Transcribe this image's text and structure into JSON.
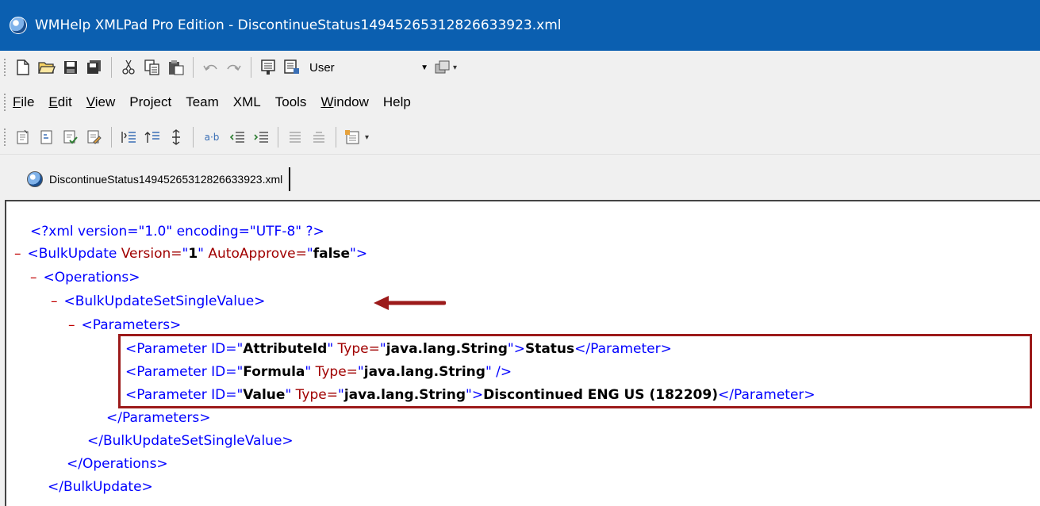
{
  "window": {
    "title": "WMHelp XMLPad Pro Edition - DiscontinueStatus14945265312826633923.xml"
  },
  "toolbar": {
    "profile_combo": "User",
    "icons": [
      "new-file-icon",
      "open-folder-icon",
      "save-icon",
      "save-all-icon",
      "cut-icon",
      "copy-icon",
      "paste-icon",
      "undo-icon",
      "redo-icon",
      "toggle-panel-icon",
      "tree-view-icon",
      "combo-dropdown-icon",
      "customize-icon"
    ]
  },
  "menu": {
    "items": [
      {
        "label": "File",
        "underline": "F"
      },
      {
        "label": "Edit",
        "underline": "E"
      },
      {
        "label": "View",
        "underline": "V"
      },
      {
        "label": "Project",
        "underline": ""
      },
      {
        "label": "Team",
        "underline": ""
      },
      {
        "label": "XML",
        "underline": ""
      },
      {
        "label": "Tools",
        "underline": ""
      },
      {
        "label": "Window",
        "underline": "W"
      },
      {
        "label": "Help",
        "underline": ""
      }
    ]
  },
  "tab": {
    "label": "DiscontinueStatus14945265312826633923.xml"
  },
  "xml": {
    "decl": "<?xml version=\"1.0\" encoding=\"UTF-8\" ?>",
    "bulk_open_tag": "<BulkUpdate",
    "bulk_attr1_name": " Version=",
    "bulk_attr1_q1": "\"",
    "bulk_attr1_value": "1",
    "bulk_attr1_q2": "\"",
    "bulk_attr2_name": " AutoApprove=",
    "bulk_attr2_q1": "\"",
    "bulk_attr2_value": "false",
    "bulk_attr2_q2": "\"",
    "bulk_close_bracket": ">",
    "operations_open": "<Operations>",
    "setsingle_open": "<BulkUpdateSetSingleValue>",
    "parameters_open": "<Parameters>",
    "param1": {
      "tag": "<Parameter ID=",
      "q": "\"",
      "id": "AttributeId",
      "type_attr": " Type=",
      "type": "java.lang.String",
      "gt": ">",
      "text": "Status",
      "close": "</Parameter>"
    },
    "param2": {
      "tag": "<Parameter ID=",
      "q": "\"",
      "id": "Formula",
      "type_attr": " Type=",
      "type": "java.lang.String",
      "selfclose": " />"
    },
    "param3": {
      "tag": "<Parameter ID=",
      "q": "\"",
      "id": "Value",
      "type_attr": " Type=",
      "type": "java.lang.String",
      "gt": ">",
      "text": "Discontinued ENG US (182209)",
      "close": "</Parameter>"
    },
    "parameters_close": "</Parameters>",
    "setsingle_close": "</BulkUpdateSetSingleValue>",
    "operations_close": "</Operations>",
    "bulk_close": "</BulkUpdate>",
    "collapse_marker": "–"
  },
  "annotation": {
    "arrow_color": "#9c1a1a",
    "box_color": "#9c1a1a"
  },
  "colors": {
    "titlebar": "#0b5fb0",
    "tag": "#0000ff",
    "attr_name": "#a00000",
    "collapse": "#c00000"
  }
}
